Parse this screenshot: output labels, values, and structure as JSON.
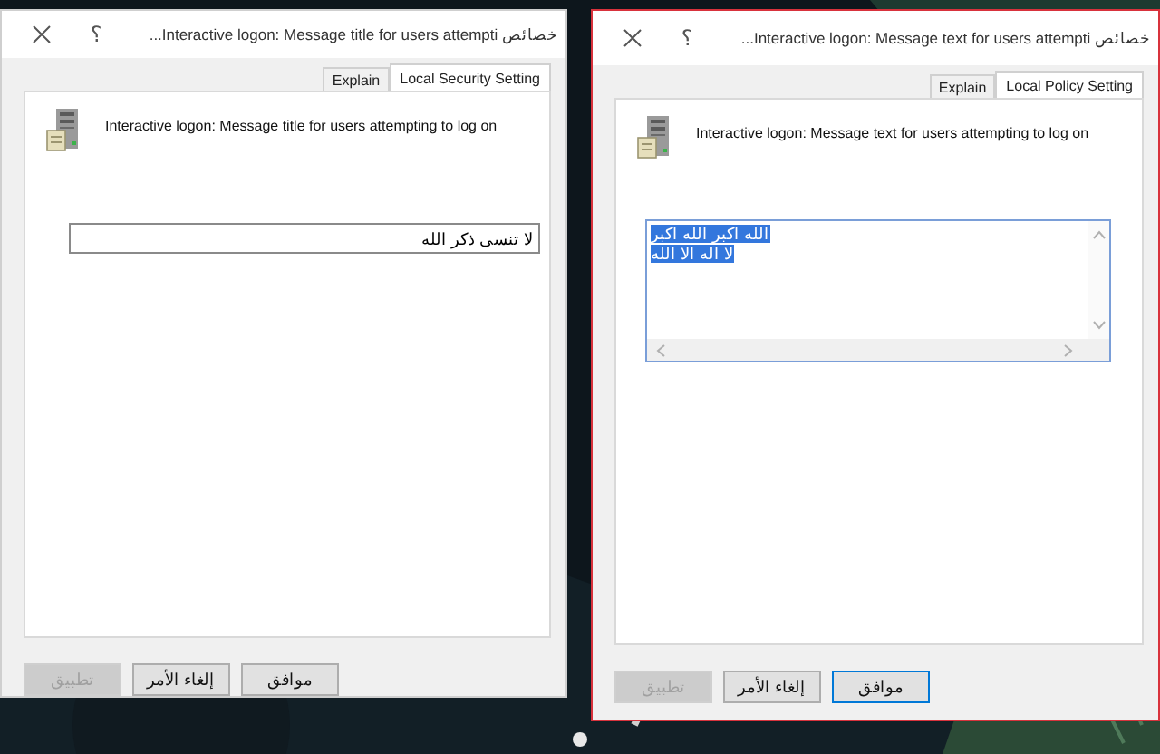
{
  "windows": [
    {
      "title": "خصائص Interactive logon: Message text for users attempti...",
      "help": "؟",
      "tabs": [
        {
          "label": "Local Policy Setting",
          "selected": true
        },
        {
          "label": "Explain",
          "selected": false
        }
      ],
      "description": "Interactive logon: Message text for users attempting to log on",
      "field": {
        "kind": "multi",
        "lines": [
          "الله اكبر الله اكبر",
          "لا اله الا الله"
        ],
        "selected": true
      },
      "buttons": [
        {
          "label": "موافق",
          "disabled": false,
          "focused": true
        },
        {
          "label": "إلغاء الأمر",
          "disabled": false,
          "focused": false
        },
        {
          "label": "تطبيق",
          "disabled": true,
          "focused": false
        }
      ],
      "active": true
    },
    {
      "title": "خصائص Interactive logon: Message title for users attempti...",
      "help": "؟",
      "tabs": [
        {
          "label": "Local Security Setting",
          "selected": true
        },
        {
          "label": "Explain",
          "selected": false
        }
      ],
      "description": "Interactive logon: Message title for users attempting to log on",
      "field": {
        "kind": "single",
        "lines": [
          "لا تنسى ذكر الله"
        ],
        "selected": false
      },
      "buttons": [
        {
          "label": "موافق",
          "disabled": false,
          "focused": false
        },
        {
          "label": "إلغاء الأمر",
          "disabled": false,
          "focused": false
        },
        {
          "label": "تطبيق",
          "disabled": true,
          "focused": false
        }
      ],
      "active": false
    }
  ]
}
